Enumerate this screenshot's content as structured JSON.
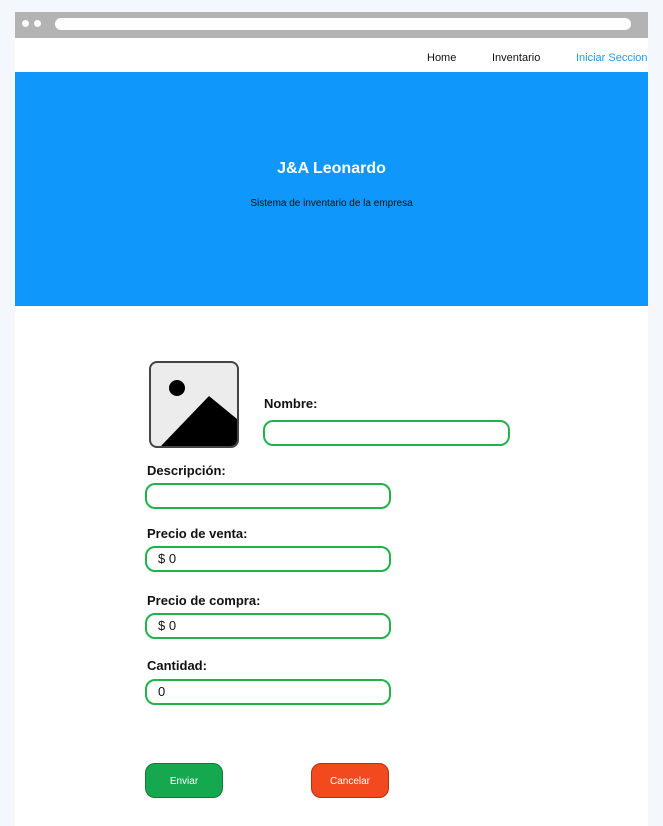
{
  "nav": {
    "home": "Home",
    "inventory": "Inventario",
    "login": "Iniciar Seccion"
  },
  "hero": {
    "title": "J&A Leonardo",
    "subtitle": "Sistema de inventario de la empresa"
  },
  "form": {
    "image_icon": "image-placeholder-icon",
    "nombre_label": "Nombre:",
    "nombre_value": "",
    "descripcion_label": "Descripción:",
    "descripcion_value": "",
    "precio_venta_label": "Precio de venta:",
    "precio_venta_value": "$ 0",
    "precio_compra_label": "Precio de compra:",
    "precio_compra_value": "$ 0",
    "cantidad_label": "Cantidad:",
    "cantidad_value": "0"
  },
  "buttons": {
    "send": "Enviar",
    "cancel": "Cancelar"
  },
  "colors": {
    "accent": "#0f97fc",
    "field_border": "#22b24c",
    "send": "#16a84f",
    "cancel": "#f24a1e"
  }
}
